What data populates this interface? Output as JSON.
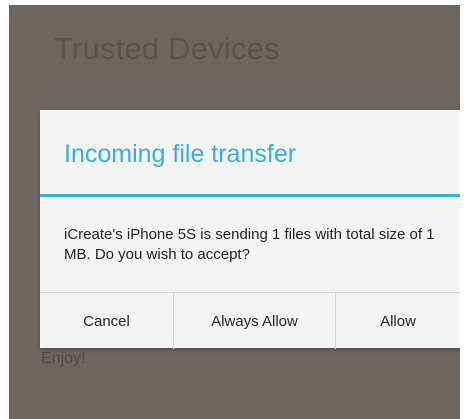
{
  "background": {
    "title": "Trusted Devices",
    "footer_text": "Enjoy!"
  },
  "dialog": {
    "title": "Incoming file transfer",
    "message": "iCreate's iPhone 5S is sending 1 files with total size of 1 MB. Do you wish to accept?",
    "buttons": {
      "cancel": "Cancel",
      "always_allow": "Always Allow",
      "allow": "Allow"
    }
  },
  "colors": {
    "accent": "#35b0dc",
    "scrim": "#6d6763",
    "dialog_background": "#f4f4f4"
  }
}
